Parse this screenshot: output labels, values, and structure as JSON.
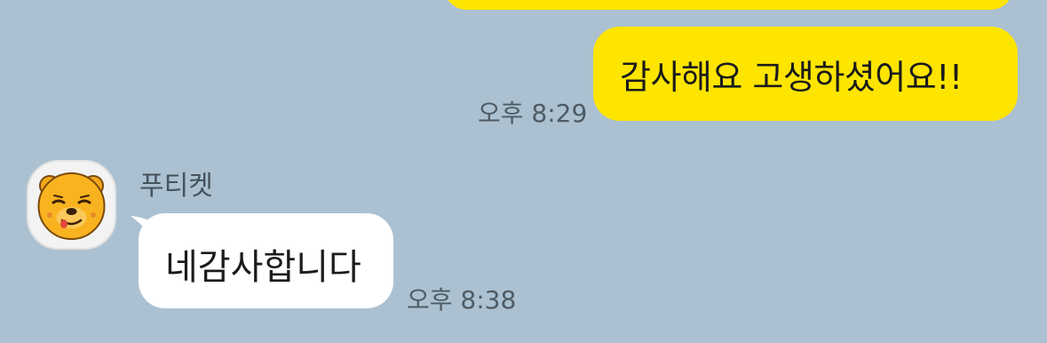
{
  "chat": {
    "background_color": "#abc1d1",
    "outgoing_color": "#fee500",
    "incoming_color": "#ffffff"
  },
  "messages": [
    {
      "direction": "outgoing",
      "text": "감사해요 고생하셨어요!!",
      "time": "오후 8:29"
    },
    {
      "direction": "incoming",
      "sender": "푸티켓",
      "avatar_icon": "winnie-the-pooh-avatar-icon",
      "text": "네감사합니다",
      "time": "오후 8:38"
    }
  ]
}
